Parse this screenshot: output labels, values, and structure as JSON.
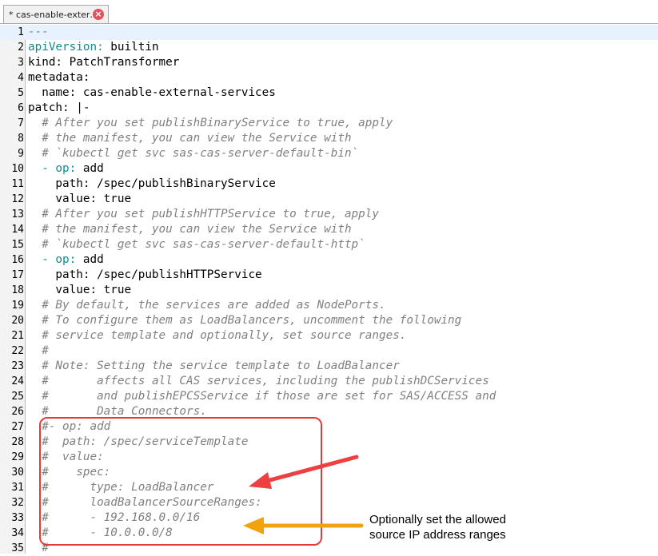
{
  "tab": {
    "title": "* cas-enable-exter…",
    "close_icon": "close-icon"
  },
  "lines": [
    {
      "n": "1",
      "segs": [
        [
          "c",
          "---"
        ]
      ]
    },
    {
      "n": "2",
      "segs": [
        [
          "k",
          "apiVersion:"
        ],
        [
          "t",
          " builtin"
        ]
      ]
    },
    {
      "n": "3",
      "segs": [
        [
          "t",
          "kind: PatchTransformer"
        ]
      ]
    },
    {
      "n": "4",
      "segs": [
        [
          "t",
          "metadata:"
        ]
      ]
    },
    {
      "n": "5",
      "segs": [
        [
          "t",
          "  name: cas-enable-external-services"
        ]
      ]
    },
    {
      "n": "6",
      "segs": [
        [
          "t",
          "patch: |-"
        ]
      ]
    },
    {
      "n": "7",
      "segs": [
        [
          "t",
          "  "
        ],
        [
          "c",
          "# After you set publishBinaryService to true, apply"
        ]
      ]
    },
    {
      "n": "8",
      "segs": [
        [
          "t",
          "  "
        ],
        [
          "c",
          "# the manifest, you can view the Service with"
        ]
      ]
    },
    {
      "n": "9",
      "segs": [
        [
          "t",
          "  "
        ],
        [
          "c",
          "# `kubectl get svc sas-cas-server-default-bin`"
        ]
      ]
    },
    {
      "n": "10",
      "segs": [
        [
          "t",
          "  "
        ],
        [
          "k",
          "- op:"
        ],
        [
          "t",
          " add"
        ]
      ]
    },
    {
      "n": "11",
      "segs": [
        [
          "t",
          "    path: /spec/publishBinaryService"
        ]
      ]
    },
    {
      "n": "12",
      "segs": [
        [
          "t",
          "    value: true"
        ]
      ]
    },
    {
      "n": "13",
      "segs": [
        [
          "t",
          "  "
        ],
        [
          "c",
          "# After you set publishHTTPService to true, apply"
        ]
      ]
    },
    {
      "n": "14",
      "segs": [
        [
          "t",
          "  "
        ],
        [
          "c",
          "# the manifest, you can view the Service with"
        ]
      ]
    },
    {
      "n": "15",
      "segs": [
        [
          "t",
          "  "
        ],
        [
          "c",
          "# `kubectl get svc sas-cas-server-default-http`"
        ]
      ]
    },
    {
      "n": "16",
      "segs": [
        [
          "t",
          "  "
        ],
        [
          "k",
          "- op:"
        ],
        [
          "t",
          " add"
        ]
      ]
    },
    {
      "n": "17",
      "segs": [
        [
          "t",
          "    path: /spec/publishHTTPService"
        ]
      ]
    },
    {
      "n": "18",
      "segs": [
        [
          "t",
          "    value: true"
        ]
      ]
    },
    {
      "n": "19",
      "segs": [
        [
          "t",
          "  "
        ],
        [
          "c",
          "# By default, the services are added as NodePorts."
        ]
      ]
    },
    {
      "n": "20",
      "segs": [
        [
          "t",
          "  "
        ],
        [
          "c",
          "# To configure them as LoadBalancers, uncomment the following"
        ]
      ]
    },
    {
      "n": "21",
      "segs": [
        [
          "t",
          "  "
        ],
        [
          "c",
          "# service template and optionally, set source ranges."
        ]
      ]
    },
    {
      "n": "22",
      "segs": [
        [
          "t",
          "  "
        ],
        [
          "c",
          "#"
        ]
      ]
    },
    {
      "n": "23",
      "segs": [
        [
          "t",
          "  "
        ],
        [
          "c",
          "# Note: Setting the service template to LoadBalancer"
        ]
      ]
    },
    {
      "n": "24",
      "segs": [
        [
          "t",
          "  "
        ],
        [
          "c",
          "#       affects all CAS services, including the publishDCServices"
        ]
      ]
    },
    {
      "n": "25",
      "segs": [
        [
          "t",
          "  "
        ],
        [
          "c",
          "#       and publishEPCSService if those are set for SAS/ACCESS and"
        ]
      ]
    },
    {
      "n": "26",
      "segs": [
        [
          "t",
          "  "
        ],
        [
          "c",
          "#       Data Connectors."
        ]
      ]
    },
    {
      "n": "27",
      "segs": [
        [
          "t",
          "  "
        ],
        [
          "c",
          "#- op: add"
        ]
      ]
    },
    {
      "n": "28",
      "segs": [
        [
          "t",
          "  "
        ],
        [
          "c",
          "#  path: /spec/serviceTemplate"
        ]
      ]
    },
    {
      "n": "29",
      "segs": [
        [
          "t",
          "  "
        ],
        [
          "c",
          "#  value:"
        ]
      ]
    },
    {
      "n": "30",
      "segs": [
        [
          "t",
          "  "
        ],
        [
          "c",
          "#    spec:"
        ]
      ]
    },
    {
      "n": "31",
      "segs": [
        [
          "t",
          "  "
        ],
        [
          "c",
          "#      type: LoadBalancer"
        ]
      ]
    },
    {
      "n": "32",
      "segs": [
        [
          "t",
          "  "
        ],
        [
          "c",
          "#      loadBalancerSourceRanges:"
        ]
      ]
    },
    {
      "n": "33",
      "segs": [
        [
          "t",
          "  "
        ],
        [
          "c",
          "#      - 192.168.0.0/16"
        ]
      ]
    },
    {
      "n": "34",
      "segs": [
        [
          "t",
          "  "
        ],
        [
          "c",
          "#      - 10.0.0.0/8"
        ]
      ]
    },
    {
      "n": "35",
      "segs": [
        [
          "t",
          "  "
        ],
        [
          "c",
          "#"
        ]
      ]
    }
  ],
  "annotation": {
    "line1": "Optionally set the allowed",
    "line2": "source IP address ranges"
  },
  "colors": {
    "keyword": "#0f8c8c",
    "comment": "#808080",
    "red_arrow": "#ee4040",
    "orange_arrow": "#f0a30a"
  }
}
